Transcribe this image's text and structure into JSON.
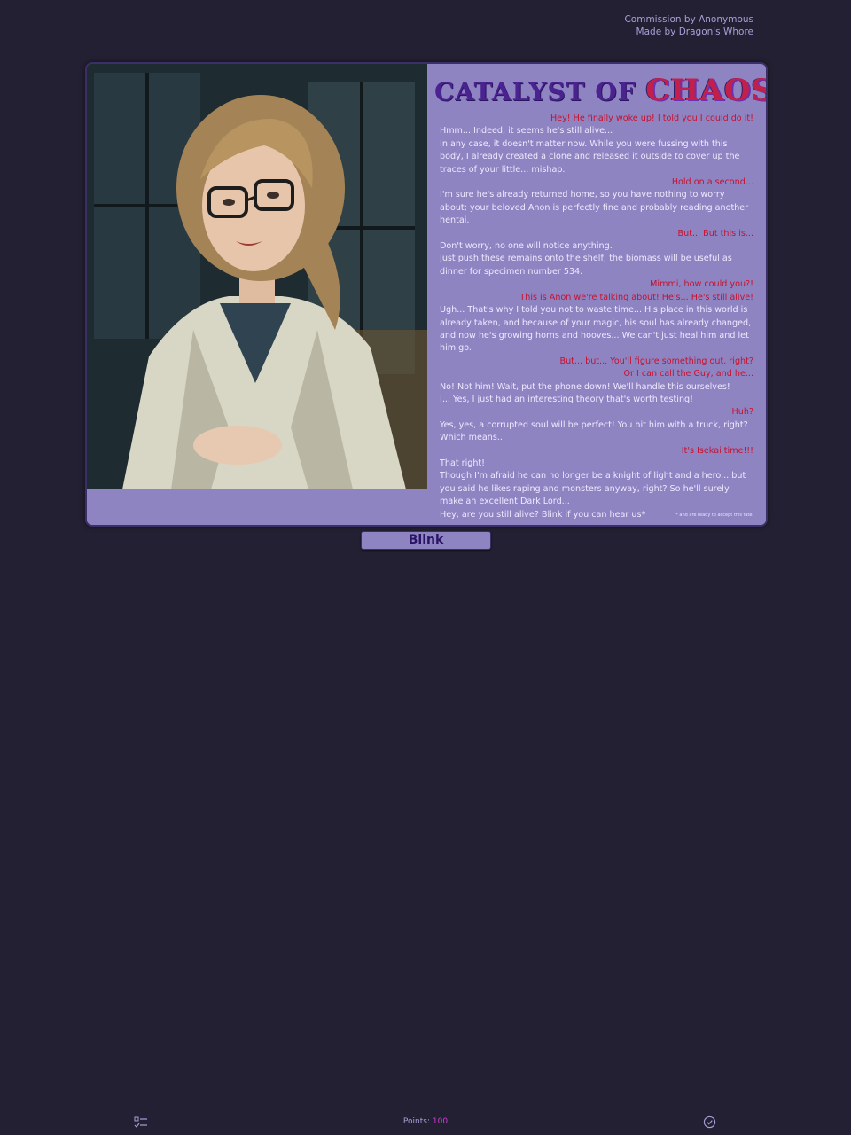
{
  "credits": {
    "commission": "Commission by Anonymous",
    "maker": "Made by Dragon's Whore"
  },
  "card": {
    "title_part1": "CATALYST OF ",
    "title_part2": "CHAOS",
    "portrait_icon": "scientist-portrait",
    "dialogue": [
      {
        "speaker": "other",
        "text": "Hey! He finally woke up! I told you I could do it!"
      },
      {
        "speaker": "self",
        "text": "Hmm... Indeed, it seems he's still alive..."
      },
      {
        "speaker": "self",
        "text": "In any case, it doesn't matter now. While you were fussing with this body, I already created a clone and released it outside to cover up the traces of your little... mishap."
      },
      {
        "speaker": "other",
        "text": "Hold on a second..."
      },
      {
        "speaker": "self",
        "text": "I'm sure he's already returned home, so you have nothing to worry about; your beloved Anon is perfectly fine and probably reading another hentai."
      },
      {
        "speaker": "other",
        "text": "But... But this is..."
      },
      {
        "speaker": "self",
        "text": "Don't worry, no one will notice anything."
      },
      {
        "speaker": "self",
        "text": "Just push these remains onto the shelf; the biomass will be useful as dinner for specimen number 534."
      },
      {
        "speaker": "other",
        "text": "Mimmi, how could you?!"
      },
      {
        "speaker": "other",
        "text": "This is Anon we're talking about! He's... He's still alive!"
      },
      {
        "speaker": "self",
        "text": "Ugh... That's why I told you not to waste time... His place in this world is already taken, and because of your magic, his soul has already changed, and now he's growing horns and hooves... We can't just heal him and let him go."
      },
      {
        "speaker": "other",
        "text": "But... but... You'll figure something out, right?"
      },
      {
        "speaker": "other",
        "text": "Or I can call the Guy, and he..."
      },
      {
        "speaker": "self",
        "text": "No! Not him! Wait, put the phone down! We'll handle this ourselves!"
      },
      {
        "speaker": "self",
        "text": "I... Yes, I just had an interesting theory that's worth testing!"
      },
      {
        "speaker": "other",
        "text": "Huh?"
      },
      {
        "speaker": "self",
        "text": "Yes, yes, a corrupted soul will be perfect! You hit him with a truck, right? Which means..."
      },
      {
        "speaker": "other",
        "text": "It's Isekai time!!!"
      },
      {
        "speaker": "self",
        "text": "That right!"
      },
      {
        "speaker": "self",
        "text": "Though I'm afraid he can no longer be a knight of light and a hero... but you said he likes raping and monsters anyway, right? So he'll surely make an excellent Dark Lord..."
      },
      {
        "speaker": "self",
        "text": "Hey, are you still alive? Blink if you can hear us*"
      }
    ],
    "footnote": "* and are ready to accept this fate."
  },
  "blink_button": {
    "label": "Blink"
  },
  "bottom_bar": {
    "list_icon": "checklist-icon",
    "points_label": "Points:",
    "points_value": "100",
    "check_icon": "check-circle-icon"
  },
  "colors": {
    "background": "#232033",
    "card": "#8f84c2",
    "other_speaker": "#c8102e",
    "self_speaker": "#efe9ff",
    "points_value": "#d33bd8"
  }
}
